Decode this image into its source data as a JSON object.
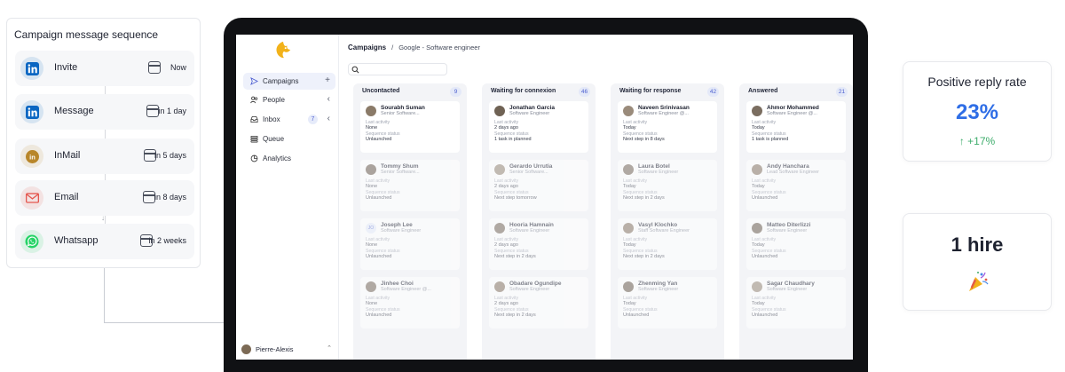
{
  "sequence": {
    "title": "Campaign message sequence",
    "steps": [
      {
        "label": "Invite",
        "delay": "Now",
        "icon": "linkedin-icon",
        "color": "#0a66c2"
      },
      {
        "label": "Message",
        "delay": "in 1 day",
        "icon": "linkedin-icon",
        "color": "#0a66c2"
      },
      {
        "label": "InMail",
        "delay": "in 5 days",
        "icon": "linkedin-inmail-icon",
        "color": "#b8862a"
      },
      {
        "label": "Email",
        "delay": "in 8 days",
        "icon": "email-icon",
        "color": "#e4574f"
      },
      {
        "label": "Whatsapp",
        "delay": "in 2 weeks",
        "icon": "whatsapp-icon",
        "color": "#25d366"
      }
    ]
  },
  "app": {
    "nav": {
      "items": [
        {
          "label": "Campaigns",
          "icon": "send-icon",
          "extra": "+"
        },
        {
          "label": "People",
          "icon": "people-icon",
          "extra": "‹"
        },
        {
          "label": "Inbox",
          "icon": "inbox-icon",
          "badge": "7",
          "extra": "‹"
        },
        {
          "label": "Queue",
          "icon": "queue-icon"
        },
        {
          "label": "Analytics",
          "icon": "analytics-icon"
        }
      ],
      "user": "Pierre-Alexis"
    },
    "breadcrumb": {
      "root": "Campaigns",
      "separator": "/",
      "current": "Google - Software engineer"
    },
    "columns": [
      {
        "title": "Uncontacted",
        "count": "9",
        "cards": [
          {
            "name": "Sourabh Suman",
            "title": "Senior Software...",
            "lbl1": "Last activity",
            "val1": "None",
            "lbl2": "Sequence status",
            "val2": "Unlaunched",
            "init": ""
          },
          {
            "name": "Tommy Shum",
            "title": "Senior Software...",
            "lbl1": "Last activity",
            "val1": "None",
            "lbl2": "Sequence status",
            "val2": "Unlaunched",
            "init": ""
          },
          {
            "name": "Joseph Lee",
            "title": "Software Engineer",
            "lbl1": "Last activity",
            "val1": "None",
            "lbl2": "Sequence status",
            "val2": "Unlaunched",
            "init": "JO"
          },
          {
            "name": "Jinhee Choi",
            "title": "Software Engineer @...",
            "lbl1": "Last activity",
            "val1": "None",
            "lbl2": "Sequence status",
            "val2": "Unlaunched",
            "init": ""
          }
        ]
      },
      {
        "title": "Waiting for connexion",
        "count": "46",
        "cards": [
          {
            "name": "Jonathan Garcia",
            "title": "Software Engineer",
            "lbl1": "Last activity",
            "val1": "2 days ago",
            "lbl2": "Sequence status",
            "val2": "1 task in planned",
            "init": ""
          },
          {
            "name": "Gerardo Urrutia",
            "title": "Senior Software...",
            "lbl1": "Last activity",
            "val1": "2 days ago",
            "lbl2": "Sequence status",
            "val2": "Next step tomorrow",
            "init": ""
          },
          {
            "name": "Hooria Hamnain",
            "title": "Software Engineer",
            "lbl1": "Last activity",
            "val1": "2 days ago",
            "lbl2": "Sequence status",
            "val2": "Next step in 2 days",
            "init": ""
          },
          {
            "name": "Obadare Ogundipe",
            "title": "Software Engineer",
            "lbl1": "Last activity",
            "val1": "2 days ago",
            "lbl2": "Sequence status",
            "val2": "Next step in 2 days",
            "init": ""
          }
        ]
      },
      {
        "title": "Waiting for response",
        "count": "42",
        "cards": [
          {
            "name": "Naveen Srinivasan",
            "title": "Software Engineer @...",
            "lbl1": "Last activity",
            "val1": "Today",
            "lbl2": "Sequence status",
            "val2": "Next step in 8 days",
            "init": ""
          },
          {
            "name": "Laura Botel",
            "title": "Software Engineer",
            "lbl1": "Last activity",
            "val1": "Today",
            "lbl2": "Sequence status",
            "val2": "Next step in 2 days",
            "init": ""
          },
          {
            "name": "Vasyl Klochko",
            "title": "Staff Software Engineer",
            "lbl1": "Last activity",
            "val1": "Today",
            "lbl2": "Sequence status",
            "val2": "Next step in 2 days",
            "init": ""
          },
          {
            "name": "Zhenming Yan",
            "title": "Software Engineer",
            "lbl1": "Last activity",
            "val1": "Today",
            "lbl2": "Sequence status",
            "val2": "Unlaunched",
            "init": ""
          }
        ]
      },
      {
        "title": "Answered",
        "count": "21",
        "cards": [
          {
            "name": "Ahmor Mohammed",
            "title": "Software Engineer @...",
            "lbl1": "Last activity",
            "val1": "Today",
            "lbl2": "Sequence status",
            "val2": "1 task is planned",
            "init": ""
          },
          {
            "name": "Andy Hanchara",
            "title": "Lead Software Engineer",
            "lbl1": "Last activity",
            "val1": "Today",
            "lbl2": "Sequence status",
            "val2": "Unlaunched",
            "init": ""
          },
          {
            "name": "Matteo Diterlizzi",
            "title": "Software Engineer",
            "lbl1": "Last activity",
            "val1": "Today",
            "lbl2": "Sequence status",
            "val2": "Unlaunched",
            "init": ""
          },
          {
            "name": "Sagar Chaudhary",
            "title": "Software Engineer",
            "lbl1": "Last activity",
            "val1": "Today",
            "lbl2": "Sequence status",
            "val2": "Unlaunched",
            "init": ""
          }
        ]
      }
    ]
  },
  "stats": {
    "reply": {
      "title": "Positive reply rate",
      "value": "23%",
      "delta": "↑ +17%",
      "value_color": "#2f6ee6",
      "delta_color": "#3dac6b"
    },
    "hire": {
      "value": "1 hire",
      "icon": "party-popper-icon"
    }
  }
}
